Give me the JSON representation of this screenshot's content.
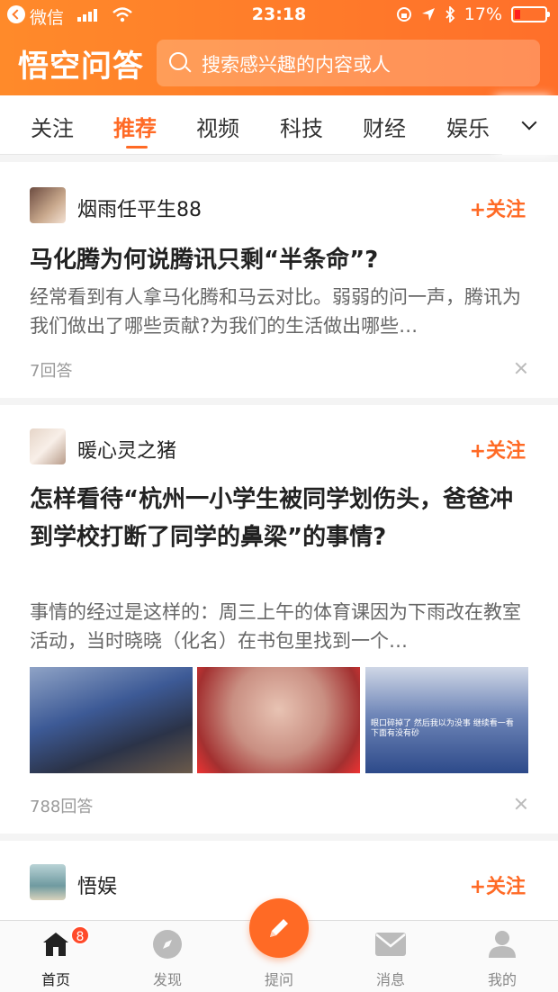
{
  "status_bar": {
    "carrier": "微信",
    "time": "23:18",
    "battery": "17%"
  },
  "header": {
    "logo": "悟空问答",
    "search_placeholder": "搜索感兴趣的内容或人"
  },
  "tabs": [
    {
      "label": "关注"
    },
    {
      "label": "推荐",
      "active": true
    },
    {
      "label": "视频"
    },
    {
      "label": "科技"
    },
    {
      "label": "财经"
    },
    {
      "label": "娱乐"
    }
  ],
  "feed": [
    {
      "user": "烟雨任平生88",
      "follow_label": "+关注",
      "title": "马化腾为何说腾讯只剩“半条命”?",
      "body": "经常看到有人拿马化腾和马云对比。弱弱的问一声，腾讯为我们做出了哪些贡献?为我们的生活做出哪些…",
      "answers": "7回答"
    },
    {
      "user": "暖心灵之猪",
      "follow_label": "+关注",
      "title": "怎样看待“杭州一小学生被同学划伤头，爸爸冲到学校打断了同学的鼻梁”的事情?",
      "body": "事情的经过是这样的：周三上午的体育课因为下雨改在教室活动，当时晓晓（化名）在书包里找到一个…",
      "answers": "788回答",
      "image_caption": "眼口碎掉了 然后我以为没事 继续看一看下面有没有砂"
    },
    {
      "user": "悟娱",
      "follow_label": "+关注"
    }
  ],
  "bottom_nav": [
    {
      "label": "首页",
      "badge": "8",
      "active": true
    },
    {
      "label": "发现"
    },
    {
      "label": "提问"
    },
    {
      "label": "消息"
    },
    {
      "label": "我的"
    }
  ],
  "colors": {
    "accent": "#ff6a25",
    "header_gradient_start": "#ff8a2a",
    "header_gradient_end": "#ff6f2a"
  }
}
